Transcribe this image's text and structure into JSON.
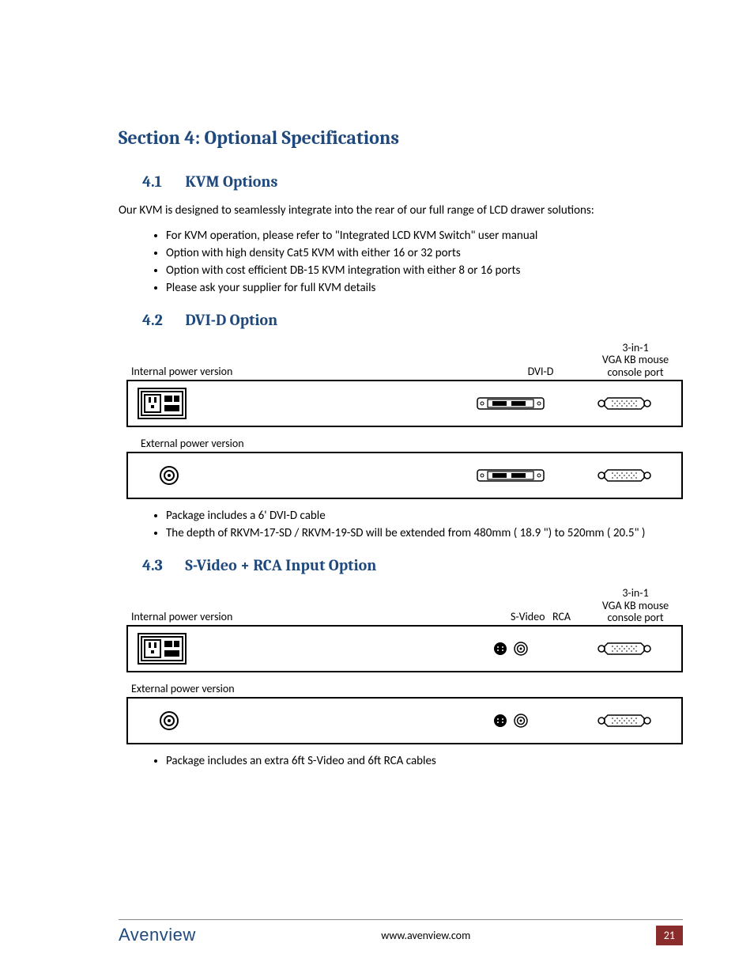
{
  "section": {
    "title": "Section 4: Optional Specifications"
  },
  "s41": {
    "num": "4.1",
    "title": "KVM Options",
    "intro": "Our KVM is designed to seamlessly integrate into the rear of our full range of LCD drawer solutions:",
    "bullets": [
      "For KVM operation, please refer to \"Integrated LCD KVM Switch\" user manual",
      "Option with high density Cat5 KVM with either 16 or 32 ports",
      "Option with cost efficient DB-15 KVM integration with either 8 or 16 ports",
      "Please ask your supplier for full KVM details"
    ]
  },
  "s42": {
    "num": "4.2",
    "title": "DVI-D Option",
    "console_label_l1": "3-in-1",
    "console_label_l2": "VGA KB mouse",
    "console_label_l3": "console port",
    "mid_label": "DVI-D",
    "internal_label": "Internal power version",
    "external_label": "External power version",
    "bullets": [
      "Package includes a 6' DVI-D cable",
      "The depth of RKVM-17-SD / RKVM-19-SD will be extended from 480mm ( 18.9 \") to 520mm ( 20.5\" )"
    ]
  },
  "s43": {
    "num": "4.3",
    "title": "S-Video + RCA Input Option",
    "console_label_l1": "3-in-1",
    "console_label_l2": "VGA KB mouse",
    "console_label_l3": "console port",
    "mid_label_sv": "S-Video",
    "mid_label_rca": "RCA",
    "internal_label": "Internal power version",
    "external_label": "External power version",
    "bullets": [
      "Package includes an extra 6ft S-Video and 6ft RCA cables"
    ]
  },
  "footer": {
    "logo": "Avenview",
    "url": "www.avenview.com",
    "page": "21"
  }
}
